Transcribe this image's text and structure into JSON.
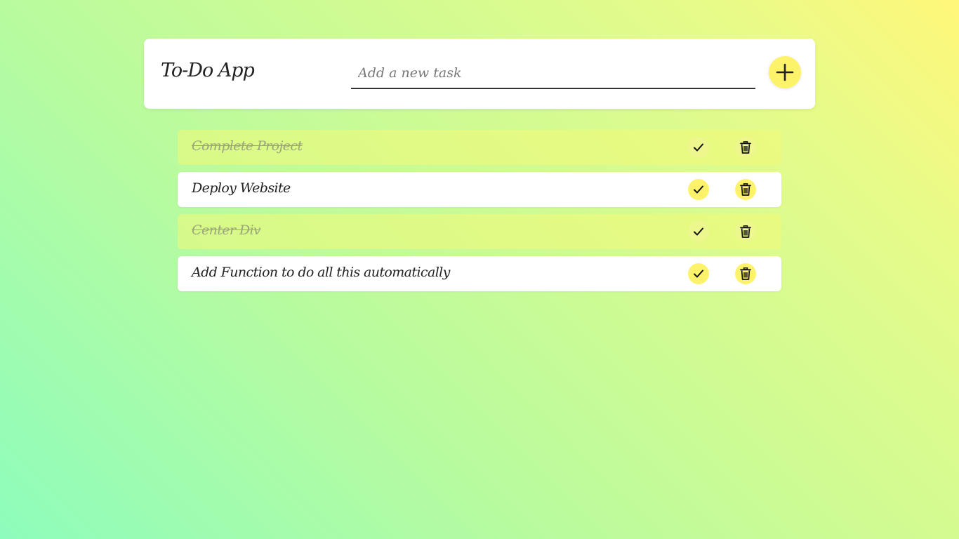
{
  "app": {
    "title": "To-Do App"
  },
  "input": {
    "placeholder": "Add a new task",
    "value": ""
  },
  "colors": {
    "accent": "#fdf36a",
    "card": "#ffffff",
    "done_card": "#f0f97a",
    "text": "#222222"
  },
  "icons": {
    "add": "plus-icon",
    "complete": "check-icon",
    "delete": "trash-icon"
  },
  "tasks": [
    {
      "text": "Complete Project",
      "completed": true
    },
    {
      "text": "Deploy Website",
      "completed": false
    },
    {
      "text": "Center Div",
      "completed": true
    },
    {
      "text": "Add Function to do all this automatically",
      "completed": false
    }
  ]
}
